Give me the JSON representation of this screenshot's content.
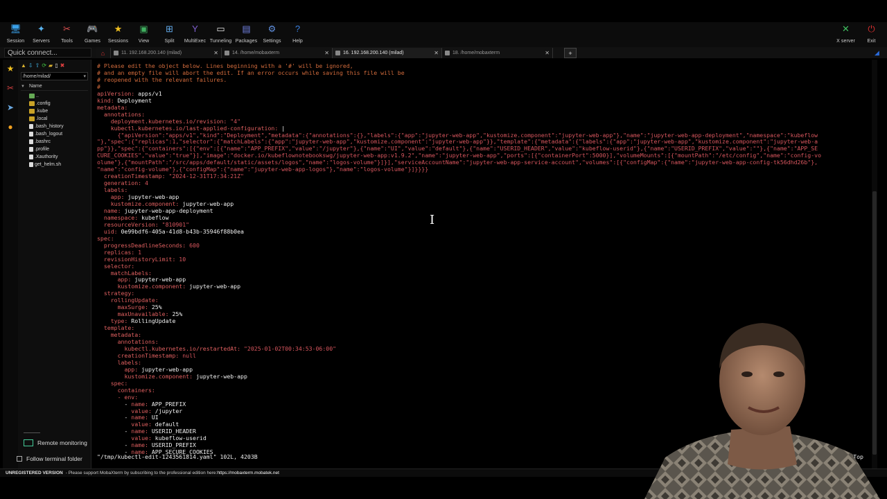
{
  "toolbar": {
    "left": [
      {
        "label": "Session",
        "icon": "session-icon",
        "color": "#3aa0e8"
      },
      {
        "label": "Servers",
        "icon": "servers-icon",
        "color": "#5ab4f0"
      },
      {
        "label": "Tools",
        "icon": "tools-icon",
        "color": "#e05050"
      },
      {
        "label": "Games",
        "icon": "games-icon",
        "color": "#d0d0d0"
      },
      {
        "label": "Sessions",
        "icon": "star-icon",
        "color": "#f0c020"
      },
      {
        "label": "View",
        "icon": "view-icon",
        "color": "#40b060"
      },
      {
        "label": "Split",
        "icon": "split-icon",
        "color": "#60a8e8"
      },
      {
        "label": "MultiExec",
        "icon": "multiexec-icon",
        "color": "#8060d0"
      },
      {
        "label": "Tunneling",
        "icon": "tunneling-icon",
        "color": "#e8e8e8"
      },
      {
        "label": "Packages",
        "icon": "packages-icon",
        "color": "#7080e0"
      },
      {
        "label": "Settings",
        "icon": "settings-icon",
        "color": "#6090e0"
      },
      {
        "label": "Help",
        "icon": "help-icon",
        "color": "#3a80e0"
      }
    ],
    "right": [
      {
        "label": "X server",
        "icon": "xserver-icon",
        "color": "#40c060"
      },
      {
        "label": "Exit",
        "icon": "power-icon",
        "color": "#e03030"
      }
    ]
  },
  "quick_connect": {
    "placeholder": "Quick connect..."
  },
  "tabs": [
    {
      "label": "11. 192.168.200.140 (milad)",
      "active": false
    },
    {
      "label": "14. /home/mobaxterm",
      "active": false
    },
    {
      "label": "16. 192.168.200.140 (milad)",
      "active": true
    },
    {
      "label": "18. /home/mobaxterm",
      "active": false
    }
  ],
  "sidebar": {
    "path": "/home/milad/",
    "tree_header": "Name",
    "files": [
      {
        "name": "..",
        "type": "up"
      },
      {
        "name": ".config",
        "type": "folder"
      },
      {
        "name": ".kube",
        "type": "folder"
      },
      {
        "name": ".local",
        "type": "folder"
      },
      {
        "name": ".bash_history",
        "type": "file"
      },
      {
        "name": ".bash_logout",
        "type": "file"
      },
      {
        "name": ".bashrc",
        "type": "file"
      },
      {
        "name": ".profile",
        "type": "file"
      },
      {
        "name": ".Xauthority",
        "type": "file"
      },
      {
        "name": "get_helm.sh",
        "type": "file"
      }
    ],
    "remote_monitoring": "Remote monitoring",
    "follow_terminal": "Follow terminal folder"
  },
  "terminal": {
    "lines": [
      {
        "t": "# Please edit the object below. Lines beginning with a '#' will be ignored,",
        "c": "cm"
      },
      {
        "t": "# and an empty file will abort the edit. If an error occurs while saving this file will be",
        "c": "cm"
      },
      {
        "t": "# reopened with the relevant failures.",
        "c": "cm"
      },
      {
        "t": "#",
        "c": "cm"
      },
      {
        "t": "apiVersion: apps/v1",
        "c": "k"
      },
      {
        "t": "kind: Deployment",
        "c": "k"
      },
      {
        "t": "metadata:",
        "c": "yk"
      },
      {
        "t": "  annotations:",
        "c": "yk"
      },
      {
        "t": "    deployment.kubernetes.io/revision: \"4\"",
        "c": "k"
      },
      {
        "t": "    kubectl.kubernetes.io/last-applied-configuration: |",
        "c": "k"
      },
      {
        "t": "      {\"apiVersion\":\"apps/v1\",\"kind\":\"Deployment\",\"metadata\":{\"annotations\":{},\"labels\":{\"app\":\"jupyter-web-app\",\"kustomize.component\":\"jupyter-web-app\"},\"name\":\"jupyter-web-app-deployment\",\"namespace\":\"kubeflow",
        "c": "str"
      },
      {
        "t": "\"},\"spec\":{\"replicas\":1,\"selector\":{\"matchLabels\":{\"app\":\"jupyter-web-app\",\"kustomize.component\":\"jupyter-web-app\"}},\"template\":{\"metadata\":{\"labels\":{\"app\":\"jupyter-web-app\",\"kustomize.component\":\"jupyter-web-a",
        "c": "str"
      },
      {
        "t": "pp\"}},\"spec\":{\"containers\":[{\"env\":[{\"name\":\"APP_PREFIX\",\"value\":\"/jupyter\"},{\"name\":\"UI\",\"value\":\"default\"},{\"name\":\"USERID_HEADER\",\"value\":\"kubeflow-userid\"},{\"name\":\"USERID_PREFIX\",\"value\":\"\"},{\"name\":\"APP_SE",
        "c": "str"
      },
      {
        "t": "CURE_COOKIES\",\"value\":\"true\"}],\"image\":\"docker.io/kubeflownotebookswg/jupyter-web-app:v1.9.2\",\"name\":\"jupyter-web-app\",\"ports\":[{\"containerPort\":5000}],\"volumeMounts\":[{\"mountPath\":\"/etc/config\",\"name\":\"config-vo",
        "c": "str"
      },
      {
        "t": "olume\"},{\"mountPath\":\"/src/apps/default/static/assets/logos\",\"name\":\"logos-volume\"}]}],\"serviceAccountName\":\"jupyter-web-app-service-account\",\"volumes\":[{\"configMap\":{\"name\":\"jupyter-web-app-config-tk56dhd26b\"},",
        "c": "str"
      },
      {
        "t": "\"name\":\"config-volume\"},{\"configMap\":{\"name\":\"jupyter-web-app-logos\"},\"name\":\"logos-volume\"}]}}}}",
        "c": "str"
      },
      {
        "t": "  creationTimestamp: \"2024-12-31T17:34:21Z\"",
        "c": "k"
      },
      {
        "t": "  generation: 4",
        "c": "k"
      },
      {
        "t": "  labels:",
        "c": "yk"
      },
      {
        "t": "    app: jupyter-web-app",
        "c": "k"
      },
      {
        "t": "    kustomize.component: jupyter-web-app",
        "c": "k"
      },
      {
        "t": "  name: jupyter-web-app-deployment",
        "c": "k"
      },
      {
        "t": "  namespace: kubeflow",
        "c": "k"
      },
      {
        "t": "  resourceVersion: \"810901\"",
        "c": "k"
      },
      {
        "t": "  uid: 0e99bdf6-405a-41d8-b43b-35946f88b0ea",
        "c": "k"
      },
      {
        "t": "spec:",
        "c": "yk"
      },
      {
        "t": "  progressDeadlineSeconds: 600",
        "c": "k"
      },
      {
        "t": "  replicas: 1",
        "c": "k"
      },
      {
        "t": "  revisionHistoryLimit: 10",
        "c": "k"
      },
      {
        "t": "  selector:",
        "c": "yk"
      },
      {
        "t": "    matchLabels:",
        "c": "yk"
      },
      {
        "t": "      app: jupyter-web-app",
        "c": "k"
      },
      {
        "t": "      kustomize.component: jupyter-web-app",
        "c": "k"
      },
      {
        "t": "  strategy:",
        "c": "yk"
      },
      {
        "t": "    rollingUpdate:",
        "c": "yk"
      },
      {
        "t": "      maxSurge: 25%",
        "c": "k"
      },
      {
        "t": "      maxUnavailable: 25%",
        "c": "k"
      },
      {
        "t": "    type: RollingUpdate",
        "c": "k"
      },
      {
        "t": "  template:",
        "c": "yk"
      },
      {
        "t": "    metadata:",
        "c": "yk"
      },
      {
        "t": "      annotations:",
        "c": "yk"
      },
      {
        "t": "        kubectl.kubernetes.io/restartedAt: \"2025-01-02T00:34:53-06:00\"",
        "c": "k"
      },
      {
        "t": "      creationTimestamp: null",
        "c": "k"
      },
      {
        "t": "      labels:",
        "c": "yk"
      },
      {
        "t": "        app: jupyter-web-app",
        "c": "k"
      },
      {
        "t": "        kustomize.component: jupyter-web-app",
        "c": "k"
      },
      {
        "t": "    spec:",
        "c": "yk"
      },
      {
        "t": "      containers:",
        "c": "yk"
      },
      {
        "t": "      - env:",
        "c": "yk"
      },
      {
        "t": "        - name: APP_PREFIX",
        "c": "k"
      },
      {
        "t": "          value: /jupyter",
        "c": "k"
      },
      {
        "t": "        - name: UI",
        "c": "k"
      },
      {
        "t": "          value: default",
        "c": "k"
      },
      {
        "t": "        - name: USERID_HEADER",
        "c": "k"
      },
      {
        "t": "          value: kubeflow-userid",
        "c": "k"
      },
      {
        "t": "        - name: USERID_PREFIX",
        "c": "k"
      },
      {
        "t": "        - name: APP_SECURE_COOKIES",
        "c": "k"
      }
    ],
    "status_left": "\"/tmp/kubectl-edit-1243561814.yaml\" 102L, 4203B",
    "status_right": "Top"
  },
  "footer": {
    "unregistered": "UNREGISTERED VERSION",
    "message": " -  Please support MobaXterm by subscribing to the professional edition here: ",
    "link": "https://mobaxterm.mobatek.net"
  }
}
